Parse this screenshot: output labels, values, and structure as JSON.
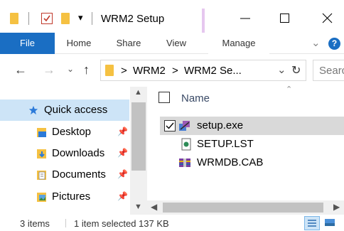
{
  "window": {
    "title": "WRM2 Setup",
    "minimize_icon": "minimize-icon",
    "maximize_icon": "maximize-icon",
    "close_icon": "close-icon"
  },
  "ribbon": {
    "tabs": [
      {
        "label": "File"
      },
      {
        "label": "Home"
      },
      {
        "label": "Share"
      },
      {
        "label": "View"
      },
      {
        "label": "Manage"
      }
    ],
    "help_label": "?"
  },
  "address": {
    "crumbs": [
      "WRM2",
      "WRM2 Se..."
    ],
    "separator": ">"
  },
  "search": {
    "placeholder": "Searc"
  },
  "navpane": {
    "items": [
      {
        "label": "Quick access",
        "icon": "star-icon",
        "selected": true
      },
      {
        "label": "Desktop",
        "icon": "desktop-folder-icon",
        "pinned": true
      },
      {
        "label": "Downloads",
        "icon": "downloads-folder-icon",
        "pinned": true
      },
      {
        "label": "Documents",
        "icon": "documents-folder-icon",
        "pinned": true
      },
      {
        "label": "Pictures",
        "icon": "pictures-folder-icon",
        "pinned": true
      }
    ]
  },
  "filelist": {
    "column_name": "Name",
    "files": [
      {
        "name": "setup.exe",
        "icon": "installer-icon",
        "selected": true,
        "checked": true
      },
      {
        "name": "SETUP.LST",
        "icon": "text-file-icon",
        "selected": false
      },
      {
        "name": "WRMDB.CAB",
        "icon": "cabinet-archive-icon",
        "selected": false
      }
    ]
  },
  "status": {
    "item_count": "3 items",
    "selection": "1 item selected  137 KB"
  },
  "colors": {
    "accent": "#1a6ec3",
    "selection": "#cde4f7",
    "row_selected": "#d9d9d9",
    "folder": "#f5c142"
  }
}
